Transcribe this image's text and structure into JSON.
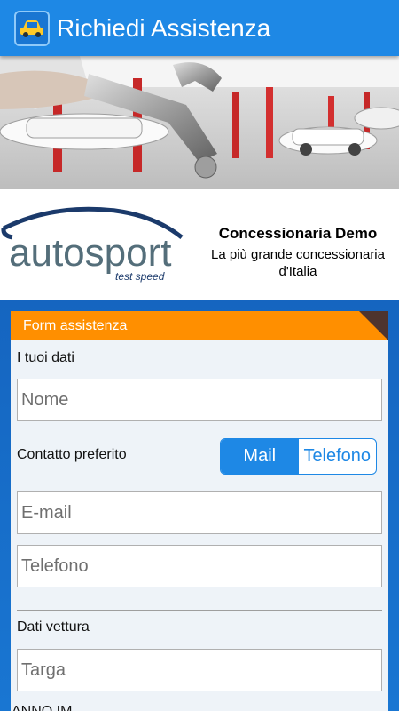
{
  "appbar": {
    "title": "Richiedi Assistenza",
    "icon": "car-icon"
  },
  "banner": {
    "image": "workshop-wrench-photo"
  },
  "dealer": {
    "logo_text": "autosport",
    "logo_subtext": "test speed",
    "name": "Concessionaria Demo",
    "tagline": "La più grande concessionaria d'Italia"
  },
  "form": {
    "header": "Form assistenza",
    "section_personal": "I tuoi dati",
    "name_placeholder": "Nome",
    "contact_label": "Contatto preferito",
    "contact_options": [
      "Mail",
      "Telefono"
    ],
    "contact_selected": "Mail",
    "email_placeholder": "E-mail",
    "phone_placeholder": "Telefono",
    "section_vehicle": "Dati vettura",
    "plate_placeholder": "Targa",
    "next_label_partial": "ANNO IM..."
  },
  "colors": {
    "appbar": "#1e88e5",
    "accent_orange": "#ff8f00",
    "background_blue": "#1565c0",
    "card_bg": "#eef3f8"
  }
}
